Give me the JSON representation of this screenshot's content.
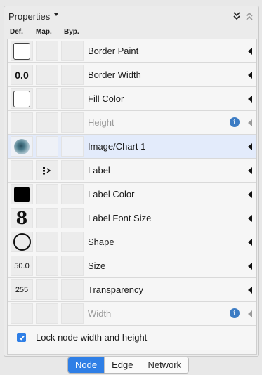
{
  "panel": {
    "title": "Properties",
    "columns": {
      "def": "Def.",
      "map": "Map.",
      "byp": "Byp."
    }
  },
  "rows": [
    {
      "label": "Border Paint"
    },
    {
      "label": "Border Width",
      "def_text": "0.0"
    },
    {
      "label": "Fill Color"
    },
    {
      "label": "Height"
    },
    {
      "label": "Image/Chart 1"
    },
    {
      "label": "Label"
    },
    {
      "label": "Label Color"
    },
    {
      "label": "Label Font Size",
      "def_text": "8"
    },
    {
      "label": "Shape"
    },
    {
      "label": "Size",
      "def_text": "50.0"
    },
    {
      "label": "Transparency",
      "def_text": "255"
    },
    {
      "label": "Width"
    }
  ],
  "info_icon_glyph": "i",
  "lock": {
    "label": "Lock node width and height",
    "checked": true
  },
  "tabs": [
    {
      "label": "Node",
      "active": true
    },
    {
      "label": "Edge",
      "active": false
    },
    {
      "label": "Network",
      "active": false
    }
  ],
  "colors": {
    "accent": "#2f7fe6",
    "selected_row": "#e3ebfb",
    "info": "#3c7cc4"
  }
}
